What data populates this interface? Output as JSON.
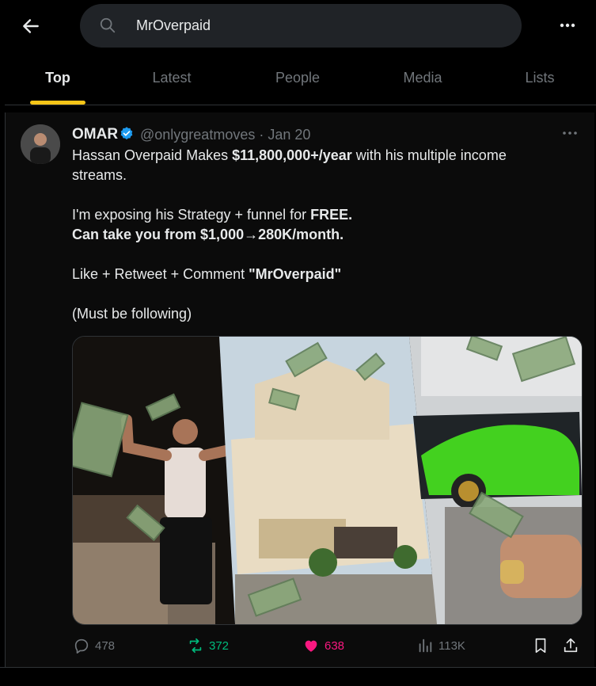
{
  "search": {
    "query": "MrOverpaid"
  },
  "tabs": [
    {
      "label": "Top"
    },
    {
      "label": "Latest"
    },
    {
      "label": "People"
    },
    {
      "label": "Media"
    },
    {
      "label": "Lists"
    }
  ],
  "tweet": {
    "author_name": "OMAR",
    "handle_time": "@onlygreatmoves · Jan 20",
    "line1_pre": "Hassan Overpaid Makes ",
    "line1_bold": "$11,800,000+/year",
    "line1_post": " with his multiple income streams.",
    "line2_pre": "I'm exposing his Strategy + funnel for ",
    "line2_bold": "FREE.",
    "line3": "Can take you from $1,000→280K/month.",
    "line4_pre": "Like + Retweet + Comment ",
    "line4_bold": "\"MrOverpaid\"",
    "line5": "(Must be following)",
    "stats": {
      "replies": "478",
      "retweets": "372",
      "likes": "638",
      "views": "113K"
    }
  },
  "colors": {
    "accent_tab": "#f5c518",
    "verified": "#1d9bf0",
    "retweet": "#00ba7c",
    "like": "#f91880",
    "muted": "#71767b"
  },
  "icons": {
    "back": "arrow-left-icon",
    "search": "search-icon",
    "more": "more-horizontal-icon",
    "verified": "verified-badge-icon",
    "reply": "reply-icon",
    "retweet": "retweet-icon",
    "like": "heart-icon",
    "views": "views-icon",
    "bookmark": "bookmark-icon",
    "share": "share-icon"
  }
}
